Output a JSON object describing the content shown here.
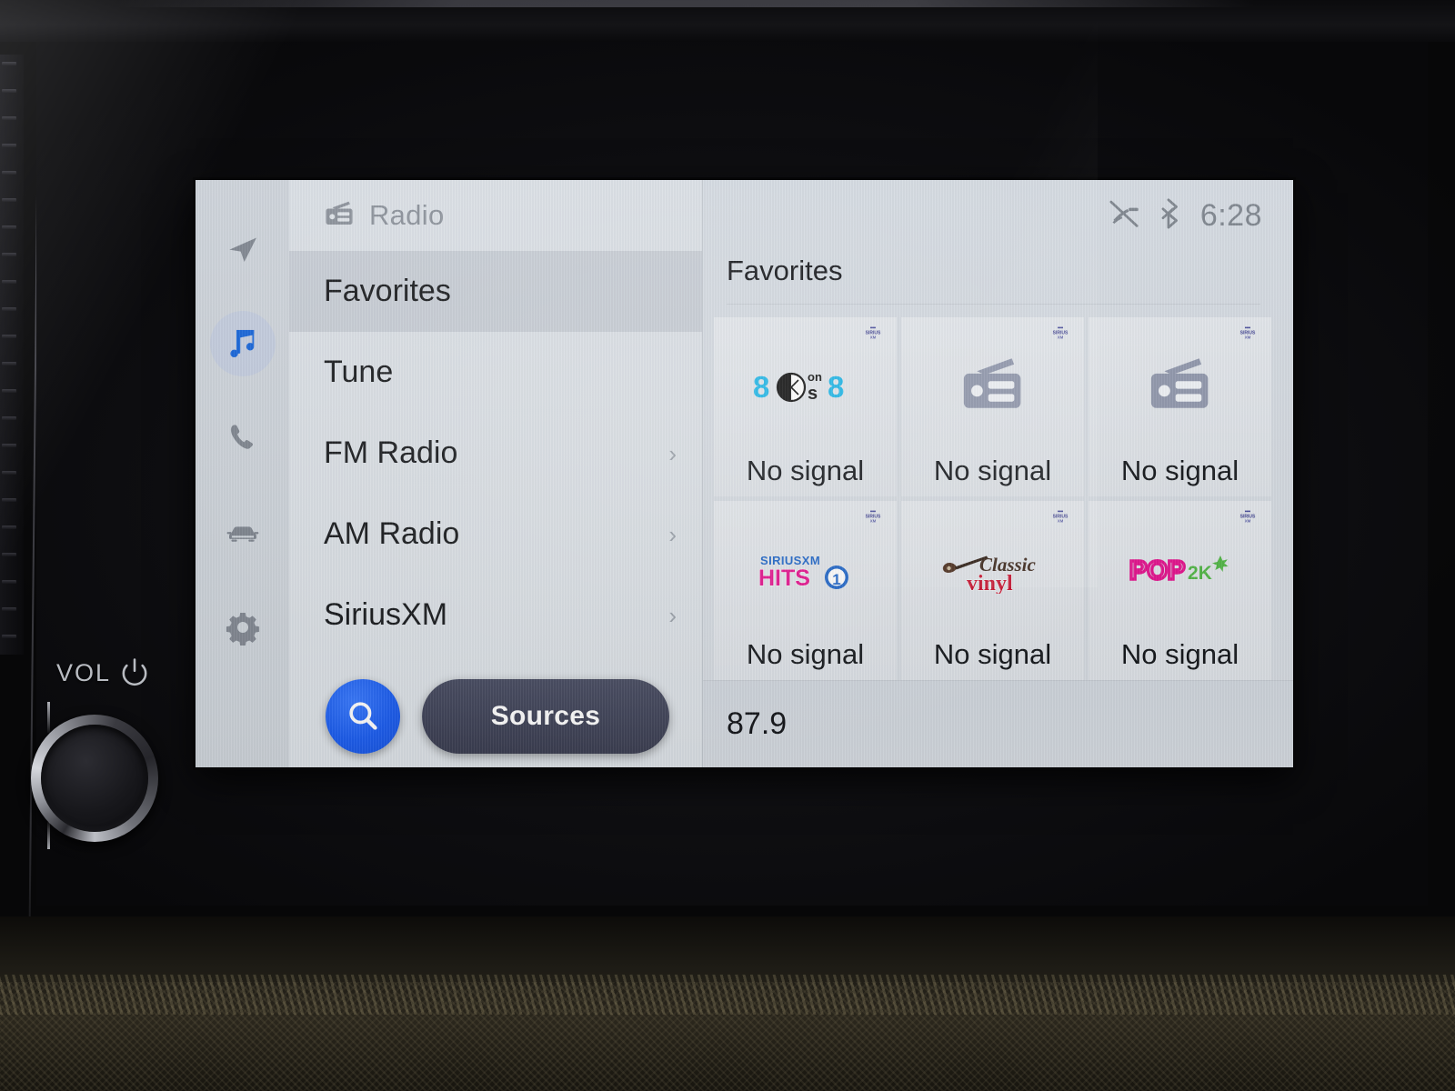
{
  "hardware": {
    "vol_label": "VOL",
    "power_icon": "power-icon",
    "knob_name": "volume-knob"
  },
  "rail": {
    "items": [
      {
        "icon": "navigation-arrow-icon",
        "name": "sidebar-item-navigation",
        "active": false
      },
      {
        "icon": "music-note-icon",
        "name": "sidebar-item-media",
        "active": true
      },
      {
        "icon": "phone-icon",
        "name": "sidebar-item-phone",
        "active": false
      },
      {
        "icon": "car-icon",
        "name": "sidebar-item-vehicle",
        "active": false
      },
      {
        "icon": "gear-icon",
        "name": "sidebar-item-settings",
        "active": false
      }
    ]
  },
  "menu": {
    "header_icon": "radio-icon",
    "header_label": "Radio",
    "items": [
      {
        "label": "Favorites",
        "selected": true,
        "chevron": false
      },
      {
        "label": "Tune",
        "selected": false,
        "chevron": false
      },
      {
        "label": "FM Radio",
        "selected": false,
        "chevron": true
      },
      {
        "label": "AM Radio",
        "selected": false,
        "chevron": true
      },
      {
        "label": "SiriusXM",
        "selected": false,
        "chevron": true
      }
    ],
    "chevron_glyph": "›",
    "search_icon": "search-icon",
    "sources_label": "Sources"
  },
  "statusbar": {
    "mic_mute_icon": "microphone-muted-icon",
    "bluetooth_icon": "bluetooth-icon",
    "clock": "6:28"
  },
  "pane": {
    "title": "Favorites",
    "tiles": [
      {
        "logo": "80s-on-8-logo",
        "logo_text": "80s on 8",
        "status": "No signal",
        "badge": "siriusxm-badge"
      },
      {
        "logo": "generic-radio-icon",
        "logo_text": "",
        "status": "No signal",
        "badge": "siriusxm-badge"
      },
      {
        "logo": "generic-radio-icon",
        "logo_text": "",
        "status": "No signal",
        "badge": "siriusxm-badge"
      },
      {
        "logo": "siriusxm-hits-1-logo",
        "logo_text": "SiriusXM Hits 1",
        "status": "No signal",
        "badge": "siriusxm-badge"
      },
      {
        "logo": "classic-vinyl-logo",
        "logo_text": "Classic vinyl",
        "status": "No signal",
        "badge": "siriusxm-badge"
      },
      {
        "logo": "pop2k-logo",
        "logo_text": "POP2K",
        "status": "No signal",
        "badge": "siriusxm-badge"
      }
    ],
    "frequency": "87.9"
  },
  "colors": {
    "accent_blue": "#1e5ff0",
    "sources_navy": "#3c3f52",
    "screen_bg": "#d5dae0",
    "selected_row": "#c6ccd4",
    "text_primary": "#121418",
    "text_muted": "#7c838c",
    "logo_cyan": "#21b7e8",
    "logo_magenta": "#e5138f",
    "logo_green": "#53b848",
    "logo_red": "#c8102e"
  }
}
